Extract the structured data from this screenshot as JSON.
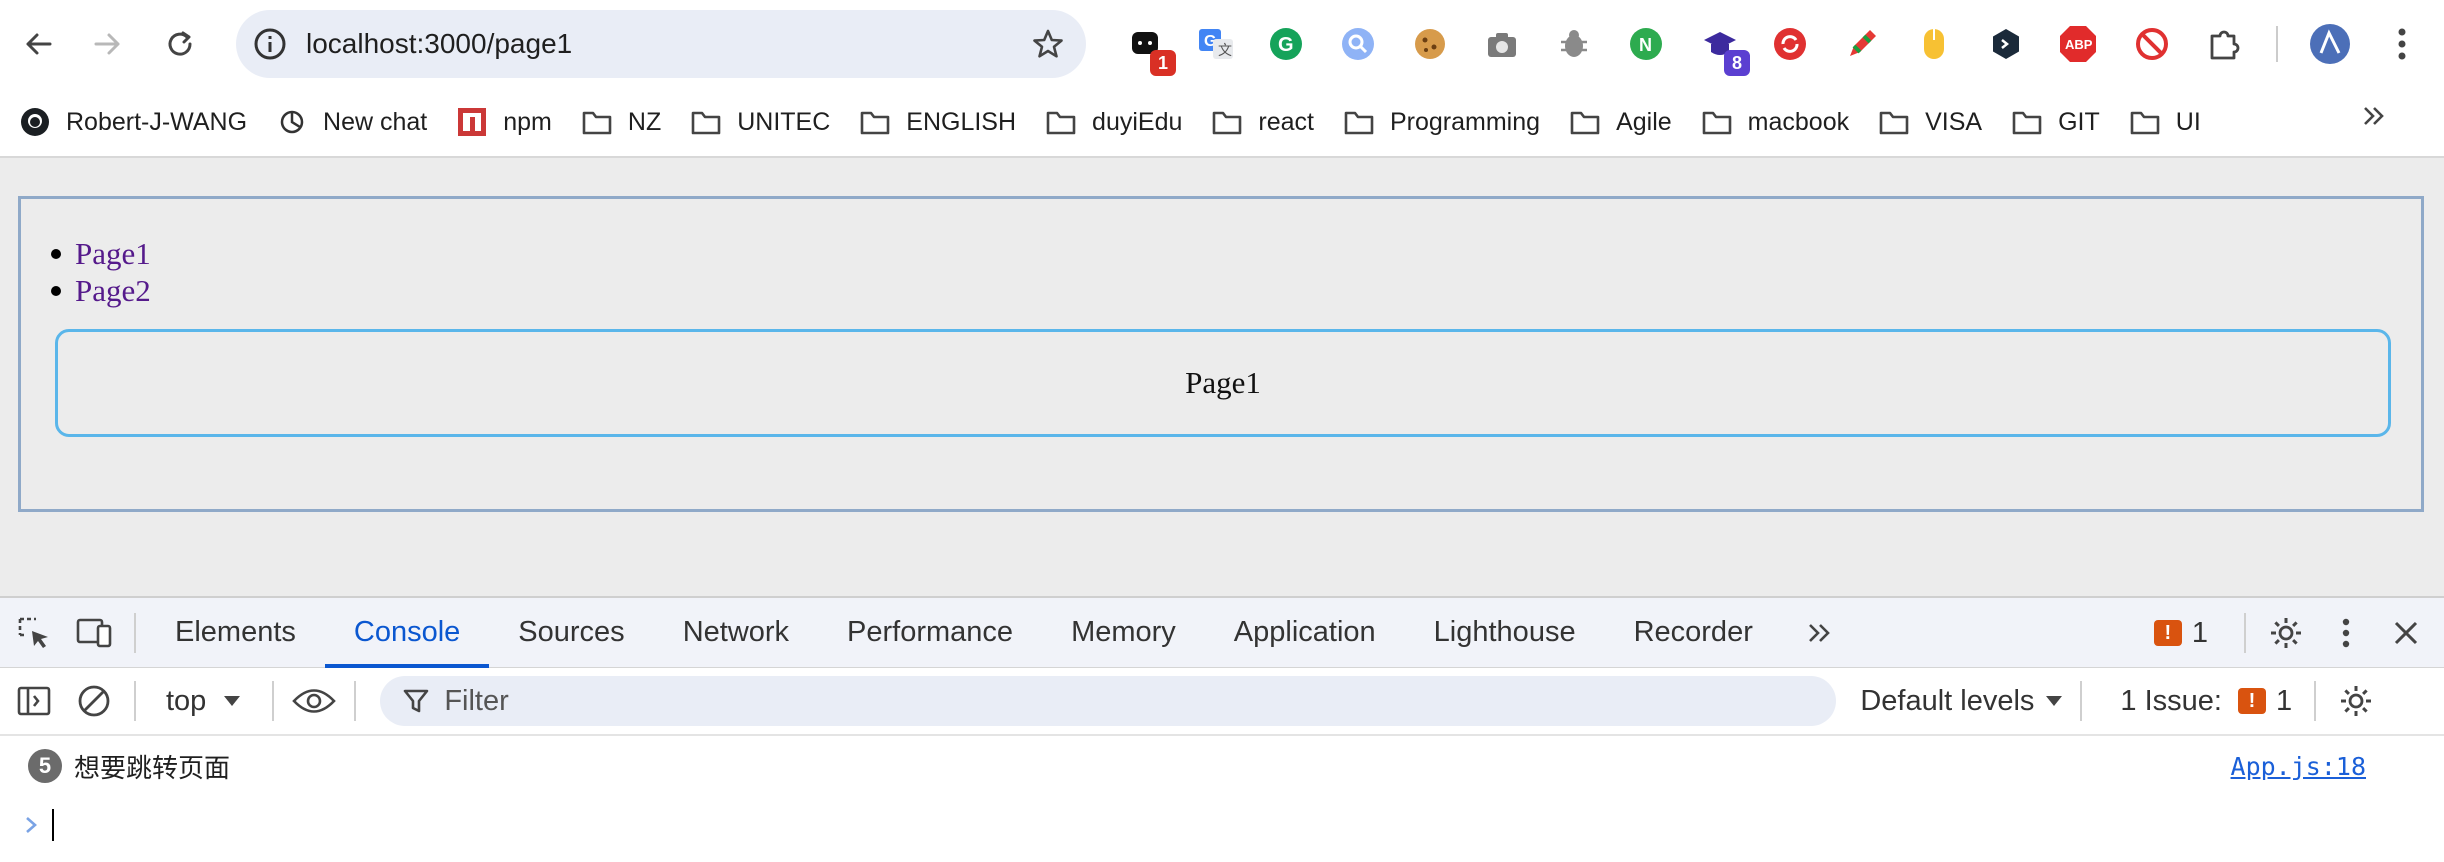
{
  "browser": {
    "url": "localhost:3000/page1",
    "extensions": [
      {
        "name": "chatgpt-ext-icon",
        "badge": "1",
        "badge_color": "#d93025"
      },
      {
        "name": "google-translate-icon"
      },
      {
        "name": "grammarly-icon"
      },
      {
        "name": "search-lens-icon"
      },
      {
        "name": "cookie-icon"
      },
      {
        "name": "camera-icon"
      },
      {
        "name": "bug-icon"
      },
      {
        "name": "node-icon"
      },
      {
        "name": "graduation-cap-icon",
        "badge": "8",
        "badge_color": "#5b3fd1"
      },
      {
        "name": "sync-icon"
      },
      {
        "name": "pen-icon"
      },
      {
        "name": "mouse-icon"
      },
      {
        "name": "code-icon"
      },
      {
        "name": "abp-icon",
        "label": "ABP"
      },
      {
        "name": "block-icon"
      },
      {
        "name": "puzzle-icon"
      },
      {
        "name": "profile-avatar-icon"
      }
    ]
  },
  "bookmarks": [
    {
      "label": "Robert-J-WANG",
      "icon": "github-icon"
    },
    {
      "label": "New chat",
      "icon": "openai-icon"
    },
    {
      "label": "npm",
      "icon": "npm-icon"
    },
    {
      "label": "NZ",
      "icon": "folder-icon"
    },
    {
      "label": "UNITEC",
      "icon": "folder-icon"
    },
    {
      "label": "ENGLISH",
      "icon": "folder-icon"
    },
    {
      "label": "duyiEdu",
      "icon": "folder-icon"
    },
    {
      "label": "react",
      "icon": "folder-icon"
    },
    {
      "label": "Programming",
      "icon": "folder-icon"
    },
    {
      "label": "Agile",
      "icon": "folder-icon"
    },
    {
      "label": "macbook",
      "icon": "folder-icon"
    },
    {
      "label": "VISA",
      "icon": "folder-icon"
    },
    {
      "label": "GIT",
      "icon": "folder-icon"
    },
    {
      "label": "UI",
      "icon": "folder-icon"
    }
  ],
  "page": {
    "links": [
      "Page1",
      "Page2"
    ],
    "content": "Page1"
  },
  "devtools": {
    "tabs": [
      "Elements",
      "Console",
      "Sources",
      "Network",
      "Performance",
      "Memory",
      "Application",
      "Lighthouse",
      "Recorder"
    ],
    "active_tab": "Console",
    "issue_count": "1",
    "context": "top",
    "filter_placeholder": "Filter",
    "levels": "Default levels",
    "issues_label": "1 Issue:",
    "issues_badge": "1",
    "log": {
      "count": "5",
      "message": "想要跳转页面",
      "source": "App.js:18"
    }
  }
}
